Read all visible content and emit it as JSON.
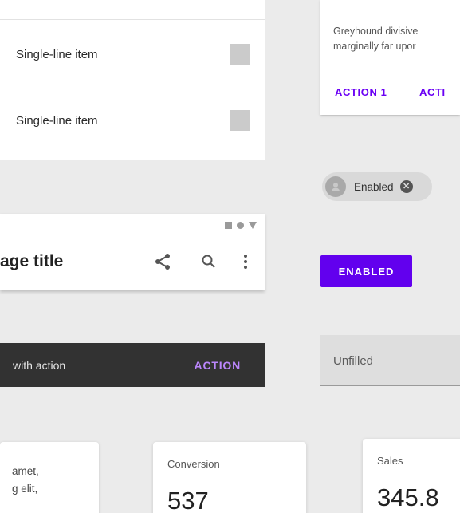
{
  "list": {
    "items": [
      {
        "label": "Single-line item"
      },
      {
        "label": "Single-line item"
      }
    ]
  },
  "info_card": {
    "line1": "Greyhound divisive",
    "line2": "marginally far upor",
    "action1": "ACTION 1",
    "action2": "ACTI"
  },
  "chip": {
    "label": "Enabled",
    "close_icon": "cancel-icon",
    "avatar_icon": "avatar-icon"
  },
  "app_bar": {
    "title": "age title",
    "icons": [
      "share-icon",
      "search-icon",
      "more-vert-icon"
    ],
    "status_icons": [
      "square-icon",
      "circle-icon",
      "triangle-icon"
    ]
  },
  "button": {
    "label": "ENABLED"
  },
  "snackbar": {
    "text": "with action",
    "action": "ACTION"
  },
  "text_field": {
    "label": "Unfilled"
  },
  "text_card": {
    "line1": "amet,",
    "line2": "g elit,"
  },
  "stat_cards": [
    {
      "label": "Conversion",
      "value": "537"
    },
    {
      "label": "Sales",
      "value": "345.8"
    }
  ],
  "colors": {
    "primary": "#6200ee",
    "action_text": "#6a00f4",
    "snackbar_bg": "#323232",
    "snackbar_action": "#bb86fc",
    "background": "#ebebeb"
  }
}
